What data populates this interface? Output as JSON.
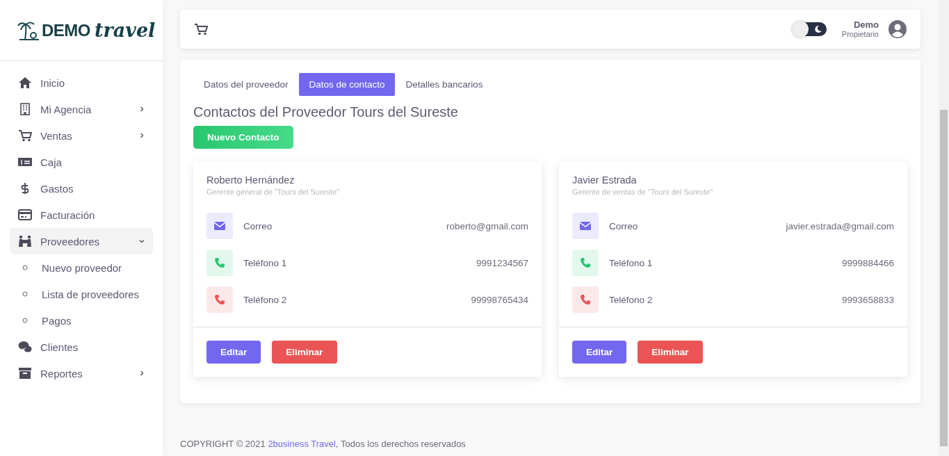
{
  "logo": {
    "brand": "DEMO",
    "script": "travel"
  },
  "sidebar": {
    "items": [
      {
        "label": "Inicio"
      },
      {
        "label": "Mi Agencia",
        "expanded": false
      },
      {
        "label": "Ventas",
        "expanded": false
      },
      {
        "label": "Caja"
      },
      {
        "label": "Gastos"
      },
      {
        "label": "Facturación"
      },
      {
        "label": "Proveedores",
        "expanded": true,
        "children": [
          {
            "label": "Nuevo proveedor"
          },
          {
            "label": "Lista de proveedores"
          },
          {
            "label": "Pagos"
          }
        ]
      },
      {
        "label": "Clientes"
      },
      {
        "label": "Reportes",
        "expanded": false
      }
    ]
  },
  "header": {
    "dark_mode_toggle": {
      "on": false
    },
    "user": {
      "name": "Demo",
      "role": "Propietario"
    }
  },
  "tabs": [
    {
      "label": "Datos del proveedor",
      "selected": false
    },
    {
      "label": "Datos de contacto",
      "selected": true
    },
    {
      "label": "Detalles bancarios",
      "selected": false
    }
  ],
  "title": "Contactos del Proveedor Tours del Sureste",
  "new_button": "Nuevo Contacto",
  "contacts": [
    {
      "name": "Roberto Hernández",
      "position": "Gerente general de \"Tours del Sureste\"",
      "rows": [
        {
          "kind": "email",
          "label": "Correo",
          "value": "roberto@gmail.com",
          "color": "#7367f0"
        },
        {
          "kind": "phone",
          "label": "Teléfono 1",
          "value": "9991234567",
          "color": "#28c76f"
        },
        {
          "kind": "phone",
          "label": "Teléfono 2",
          "value": "99998765434",
          "color": "#ea5455"
        }
      ],
      "buttons": [
        "Editar",
        "Eliminar"
      ]
    },
    {
      "name": "Javier Estrada",
      "position": "Gerente de ventas de \"Tours del Sureste\"",
      "rows": [
        {
          "kind": "email",
          "label": "Correo",
          "value": "javier.estrada@gmail.com",
          "color": "#7367f0"
        },
        {
          "kind": "phone",
          "label": "Teléfono 1",
          "value": "9999884466",
          "color": "#28c76f"
        },
        {
          "kind": "phone",
          "label": "Teléfono 2",
          "value": "9993658833",
          "color": "#ea5455"
        }
      ],
      "buttons": [
        "Editar",
        "Eliminar"
      ]
    }
  ],
  "footer": {
    "text_before": "COPYRIGHT © 2021",
    "link": "2business Travel",
    "text_after": ", Todos los derechos reservados"
  }
}
